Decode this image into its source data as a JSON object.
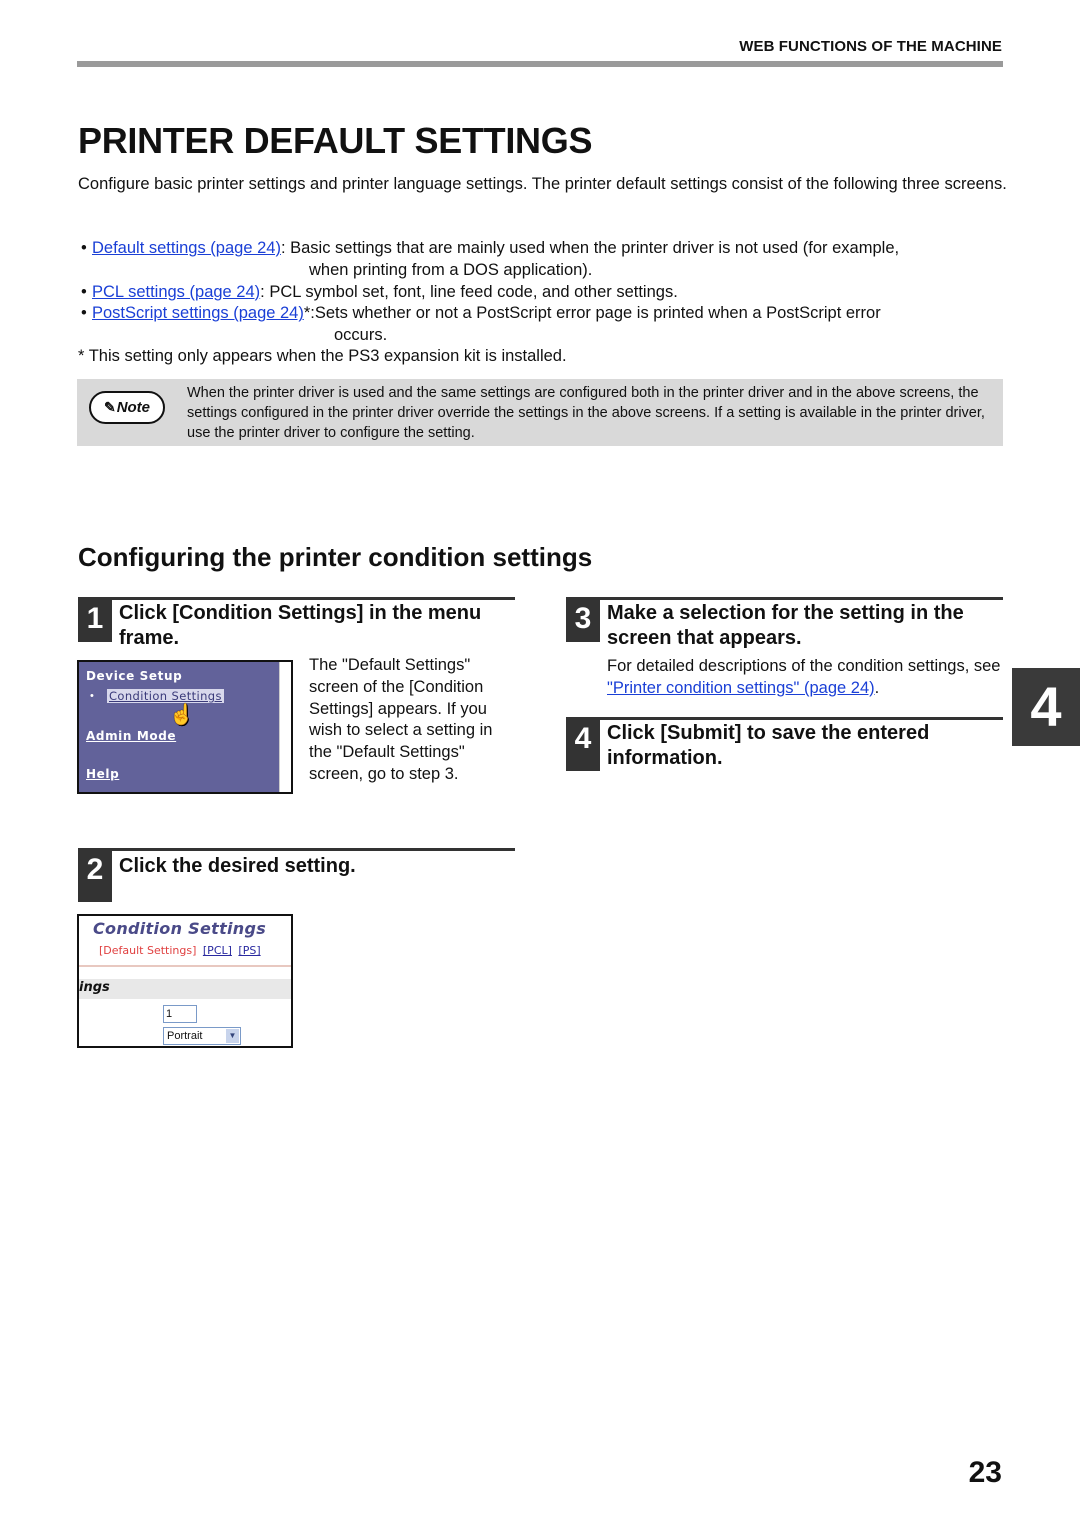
{
  "header": {
    "section_label": "WEB FUNCTIONS OF THE MACHINE"
  },
  "page_title": "PRINTER DEFAULT SETTINGS",
  "intro": "Configure basic printer settings and printer language settings. The printer default settings consist of the following three screens.",
  "bullets": [
    {
      "link": "Default settings (page 24)",
      "text": ": Basic settings that are mainly used when the printer driver is not used (for example,",
      "continuation": "when printing from a DOS application)."
    },
    {
      "link": "PCL settings (page 24)",
      "text": ": PCL symbol set, font, line feed code, and other settings.",
      "continuation": ""
    },
    {
      "link": "PostScript settings (page 24)",
      "text": "*:Sets whether or not a PostScript error page is printed when a PostScript error",
      "continuation": "occurs."
    }
  ],
  "footnote": "* This setting only appears when the PS3 expansion kit is installed.",
  "note": {
    "badge": "Note",
    "text": "When the printer driver is used and the same settings are configured both in the printer driver and in the above screens, the settings configured in the printer driver override the settings in the above screens. If a setting is available in the printer driver, use the printer driver to configure the setting."
  },
  "section_title": "Configuring the printer condition settings",
  "steps": [
    {
      "number": "1",
      "title": "Click [Condition Settings] in the menu frame.",
      "description": "The \"Default Settings\" screen of the [Condition Settings] appears. If you wish to select a setting in the \"Default Settings\" screen, go to step 3."
    },
    {
      "number": "2",
      "title": "Click the desired setting."
    },
    {
      "number": "3",
      "title": "Make a selection for the setting in the screen that appears.",
      "description_prefix": "For detailed descriptions of the condition settings, see ",
      "description_link": "\"Printer condition settings\" (page 24)",
      "description_suffix": "."
    },
    {
      "number": "4",
      "title": "Click [Submit] to save the entered information."
    }
  ],
  "menu_screenshot": {
    "heading": "Device Setup",
    "sub_item": "Condition Settings",
    "items": [
      "Admin Mode",
      "Help"
    ]
  },
  "condition_screenshot": {
    "title": "Condition Settings",
    "active_tab": "[Default Settings]",
    "tabs": [
      "[PCL]",
      "[PS]"
    ],
    "band_label": "ings",
    "input_value": "1",
    "select_value": "Portrait"
  },
  "chapter_tab": "4",
  "page_number": "23"
}
